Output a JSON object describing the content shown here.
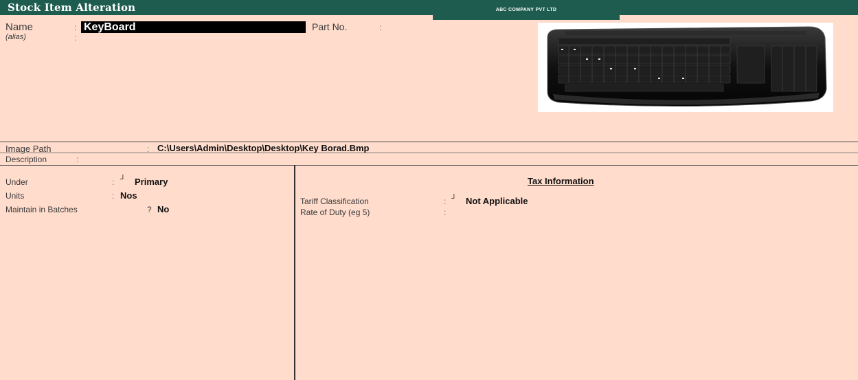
{
  "header": {
    "title": "Stock Item Alteration",
    "company": "ABC COMPANY PVT LTD"
  },
  "item": {
    "name_label": "Name",
    "name_value": "KeyBoard",
    "alias_label": "(alias)",
    "part_no_label": "Part No.",
    "colon": ":"
  },
  "image": {
    "path_label": "Image Path",
    "path_value": "C:\\Users\\Admin\\Desktop\\Desktop\\Key Borad.Bmp",
    "icon": "keyboard-image"
  },
  "description": {
    "label": "Description",
    "colon": ":"
  },
  "left_panel": {
    "under_label": "Under",
    "under_value": "Primary",
    "units_label": "Units",
    "units_value": "Nos",
    "batches_label": "Maintain in Batches",
    "batches_marker": "?",
    "batches_value": "No",
    "arrow_symbol": "┘"
  },
  "tax": {
    "heading": "Tax Information",
    "tariff_label": "Tariff Classification",
    "tariff_value": "Not Applicable",
    "rate_label": "Rate of Duty (eg 5)",
    "colon": ":"
  },
  "colors": {
    "background": "#ffdccc",
    "header": "#1d5c4f"
  }
}
